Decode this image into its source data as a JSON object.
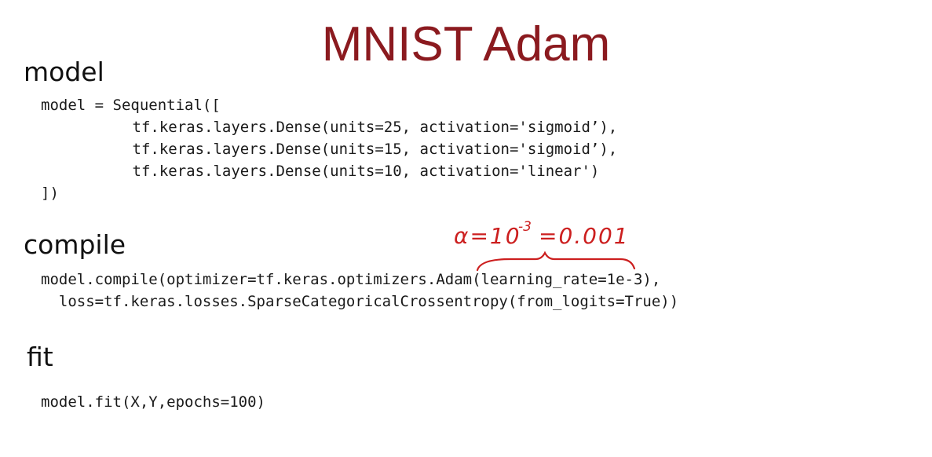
{
  "slide": {
    "title": "MNIST Adam"
  },
  "sections": {
    "model": {
      "heading": "model",
      "lines": [
        "model = Sequential([",
        "        tf.keras.layers.Dense(units=25, activation='sigmoid’),",
        "        tf.keras.layers.Dense(units=15, activation='sigmoid’),",
        "        tf.keras.layers.Dense(units=10, activation='linear')",
        "])"
      ]
    },
    "compile": {
      "heading": "compile",
      "lines": [
        "model.compile(optimizer=tf.keras.optimizers.Adam(learning_rate=1e-3),",
        "  loss=tf.keras.losses.SparseCategoricalCrossentropy(from_logits=True))"
      ]
    },
    "fit": {
      "heading": "fit",
      "lines": [
        "model.fit(X,Y,epochs=100)"
      ]
    }
  },
  "annotation": {
    "lhs": "α=10",
    "exponent": "-3",
    "rhs": "=0.001",
    "color": "#cc1f1f"
  },
  "colors": {
    "title": "#8b1a1f",
    "text": "#111111"
  }
}
